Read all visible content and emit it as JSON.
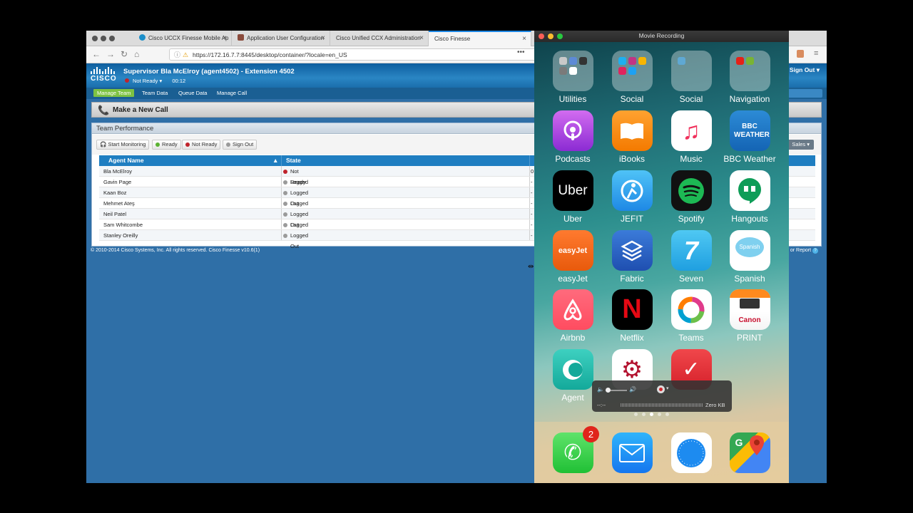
{
  "browser": {
    "tabs": [
      {
        "label": "Cisco UCCX Finesse Mobile Ap",
        "close": "×"
      },
      {
        "label": "Application User Configuration",
        "close": "×"
      },
      {
        "label": "Cisco Unified CCX Administration",
        "close": "×"
      },
      {
        "label": "Cisco Finesse",
        "close": "×"
      }
    ],
    "url": "https://172.16.7.7:8445/desktop/container/?locale=en_US",
    "url_more": "•••"
  },
  "finesse": {
    "logo_text": "CISCO",
    "title": "Supervisor Bla McElroy (agent4502) - Extension 4502",
    "status": "Not Ready",
    "status_timer": "00:12",
    "sign_out": "Sign Out",
    "nav": [
      "Manage Team",
      "Team Data",
      "Queue Data",
      "Manage Call"
    ],
    "make_call": "Make a New Call",
    "team_perf_title": "Team Performance",
    "toolbar": {
      "start_monitoring": "Start Monitoring",
      "ready": "Ready",
      "not_ready": "Not Ready",
      "sign_out": "Sign Out",
      "team_dropdown": "Sales"
    },
    "table": {
      "headers": [
        "Agent Name",
        "State"
      ],
      "sort_indicator": "▲",
      "rows": [
        {
          "name": "Bla McElroy",
          "state": "Not Ready",
          "extra": "0"
        },
        {
          "name": "Gavin Page",
          "state": "Logged Out",
          "extra": "-"
        },
        {
          "name": "Kaan Boz",
          "state": "Logged Out",
          "extra": "-"
        },
        {
          "name": "Mehmet Ateş",
          "state": "Logged Out",
          "extra": "-"
        },
        {
          "name": "Neil Patel",
          "state": "Logged Out",
          "extra": "-"
        },
        {
          "name": "Sam Whitcombe",
          "state": "Logged Out",
          "extra": "-"
        },
        {
          "name": "Stanley Oreilly",
          "state": "Logged Out",
          "extra": "-"
        }
      ]
    },
    "footer": "© 2010-2014 Cisco Systems, Inc. All rights reserved. Cisco Finesse v10.6(1)",
    "footer_right": "or Report"
  },
  "recorder": {
    "window_title": "Movie Recording",
    "time": "--:--",
    "size": "Zero KB"
  },
  "phone": {
    "apps": [
      {
        "label": "Utilities",
        "icon": "utilities-folder-icon"
      },
      {
        "label": "Social",
        "icon": "social-folder-icon"
      },
      {
        "label": "Social",
        "icon": "social-folder-2-icon"
      },
      {
        "label": "Navigation",
        "icon": "navigation-folder-icon"
      },
      {
        "label": "Podcasts",
        "icon": "podcasts-icon"
      },
      {
        "label": "iBooks",
        "icon": "ibooks-icon"
      },
      {
        "label": "Music",
        "icon": "music-icon"
      },
      {
        "label": "BBC Weather",
        "icon": "bbc-weather-icon",
        "glyph": "BBC WEATHER"
      },
      {
        "label": "Uber",
        "icon": "uber-icon",
        "glyph": "Uber"
      },
      {
        "label": "JEFIT",
        "icon": "jefit-icon"
      },
      {
        "label": "Spotify",
        "icon": "spotify-icon"
      },
      {
        "label": "Hangouts",
        "icon": "hangouts-icon"
      },
      {
        "label": "easyJet",
        "icon": "easyjet-icon",
        "glyph": "easyJet"
      },
      {
        "label": "Fabric",
        "icon": "fabric-icon"
      },
      {
        "label": "Seven",
        "icon": "seven-icon",
        "glyph": "7"
      },
      {
        "label": "Spanish",
        "icon": "spanish-icon",
        "glyph": "Spanish"
      },
      {
        "label": "Airbnb",
        "icon": "airbnb-icon"
      },
      {
        "label": "Netflix",
        "icon": "netflix-icon",
        "glyph": "N"
      },
      {
        "label": "Teams",
        "icon": "teams-icon"
      },
      {
        "label": "PRINT",
        "icon": "canon-print-icon",
        "glyph": "Canon"
      },
      {
        "label": "Agent",
        "icon": "agent-icon"
      }
    ],
    "dock": [
      {
        "icon": "phone-icon",
        "badge": "2"
      },
      {
        "icon": "mail-icon"
      },
      {
        "icon": "safari-icon"
      },
      {
        "icon": "google-maps-icon"
      }
    ]
  },
  "colors": {
    "finesse_blue": "#2f6fa7",
    "nav_active": "#7dc242",
    "table_header": "#1f7ec1",
    "not_ready_red": "#c0232b"
  }
}
